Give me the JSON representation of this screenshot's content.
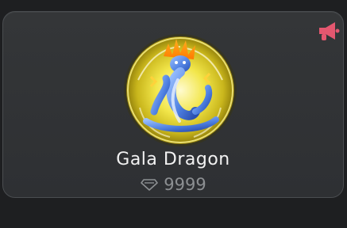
{
  "gift_card": {
    "name": "Gala Dragon",
    "price": "9999",
    "price_icon": "diamond-outline-icon",
    "promo_icon": "megaphone-icon",
    "colors": {
      "card_bg": "#323437",
      "card_border": "#4a4d50",
      "megaphone": "#e4576f",
      "medallion_glow": "#f2e64a",
      "dragon": "#4d7fe0",
      "name_text": "#f2f2f2",
      "price_text": "#8c8f92"
    }
  }
}
